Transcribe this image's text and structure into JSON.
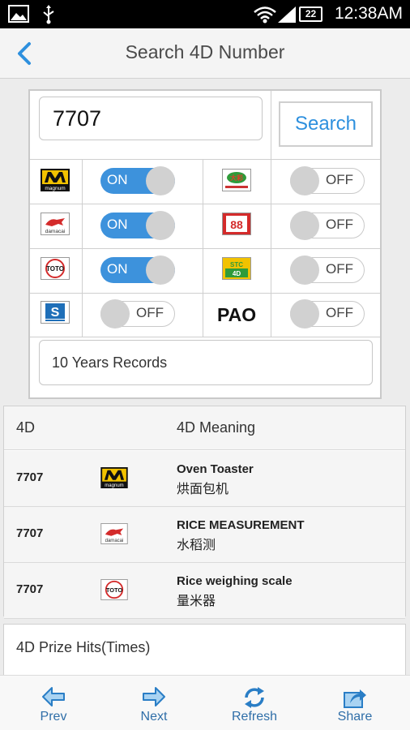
{
  "status_bar": {
    "time": "12:38AM",
    "battery": "22",
    "icons": [
      "gallery-icon",
      "usb-icon",
      "wifi-icon",
      "signal-icon",
      "battery-icon"
    ]
  },
  "header": {
    "title": "Search 4D Number",
    "back_icon": "chevron-left-icon"
  },
  "search": {
    "value": "7707",
    "button_label": "Search"
  },
  "operators": [
    {
      "name": "magnum",
      "logo_text": "magnum",
      "toggle": "ON"
    },
    {
      "name": "damacai",
      "logo_text": "damacai",
      "toggle": "ON"
    },
    {
      "name": "toto",
      "logo_text": "TOTO",
      "toggle": "ON"
    },
    {
      "name": "singapore-pools",
      "logo_text": "S",
      "toggle": "OFF"
    },
    {
      "name": "special-cash-sweep",
      "logo_text": "大彩",
      "toggle": "OFF"
    },
    {
      "name": "sabah-88",
      "logo_text": "88",
      "toggle": "OFF"
    },
    {
      "name": "stc",
      "logo_text": "STC 4D",
      "toggle": "OFF"
    },
    {
      "name": "pao",
      "logo_text": "PAO",
      "toggle": "OFF"
    }
  ],
  "records": {
    "label": "10 Years Records"
  },
  "results": {
    "headers": [
      "4D",
      "4D Meaning"
    ],
    "rows": [
      {
        "number": "7707",
        "operator": "magnum",
        "meaning_en": "Oven Toaster",
        "meaning_zh": "烘面包机"
      },
      {
        "number": "7707",
        "operator": "damacai",
        "meaning_en": "RICE MEASUREMENT",
        "meaning_zh": "水稻测"
      },
      {
        "number": "7707",
        "operator": "toto",
        "meaning_en": "Rice weighing scale",
        "meaning_zh": "量米器"
      }
    ]
  },
  "prize": {
    "label": "4D Prize Hits(Times)"
  },
  "bottom_nav": [
    {
      "label": "Prev",
      "icon": "arrow-left-icon"
    },
    {
      "label": "Next",
      "icon": "arrow-right-icon"
    },
    {
      "label": "Refresh",
      "icon": "refresh-icon"
    },
    {
      "label": "Share",
      "icon": "share-icon"
    }
  ],
  "colors": {
    "accent": "#3d92dc",
    "link": "#2e90de",
    "nav_text": "#2f6ea8"
  }
}
